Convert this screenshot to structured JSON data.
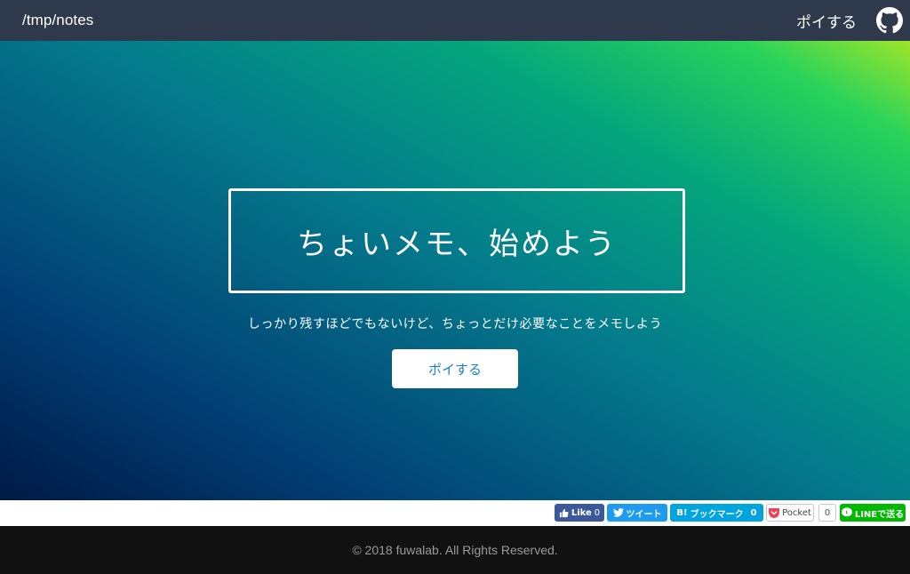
{
  "navbar": {
    "brand": "/tmp/notes",
    "link_label": "ポイする",
    "github_icon": "github-icon"
  },
  "hero": {
    "title": "ちょいメモ、始めよう",
    "subtitle": "しっかり残すほどでもないけど、ちょっとだけ必要なことをメモしよう",
    "cta_label": "ポイする",
    "gradient_colors": [
      "#001945",
      "#023f75",
      "#047b8c",
      "#05a67c",
      "#2ad35a",
      "#9ee52a"
    ]
  },
  "share": {
    "facebook": {
      "label": "Like",
      "count": "0",
      "icon": "thumbs-up-icon"
    },
    "twitter": {
      "label": "ツイート",
      "icon": "twitter-bird-icon"
    },
    "hatena": {
      "label": "ブックマーク",
      "badge": "B!",
      "count": "0"
    },
    "pocket": {
      "label": "Pocket",
      "count": "0",
      "icon": "pocket-icon"
    },
    "line": {
      "label": "LINEで送る",
      "icon": "line-icon"
    }
  },
  "footer": {
    "copyright": "© 2018 fuwalab. All Rights Reserved."
  }
}
